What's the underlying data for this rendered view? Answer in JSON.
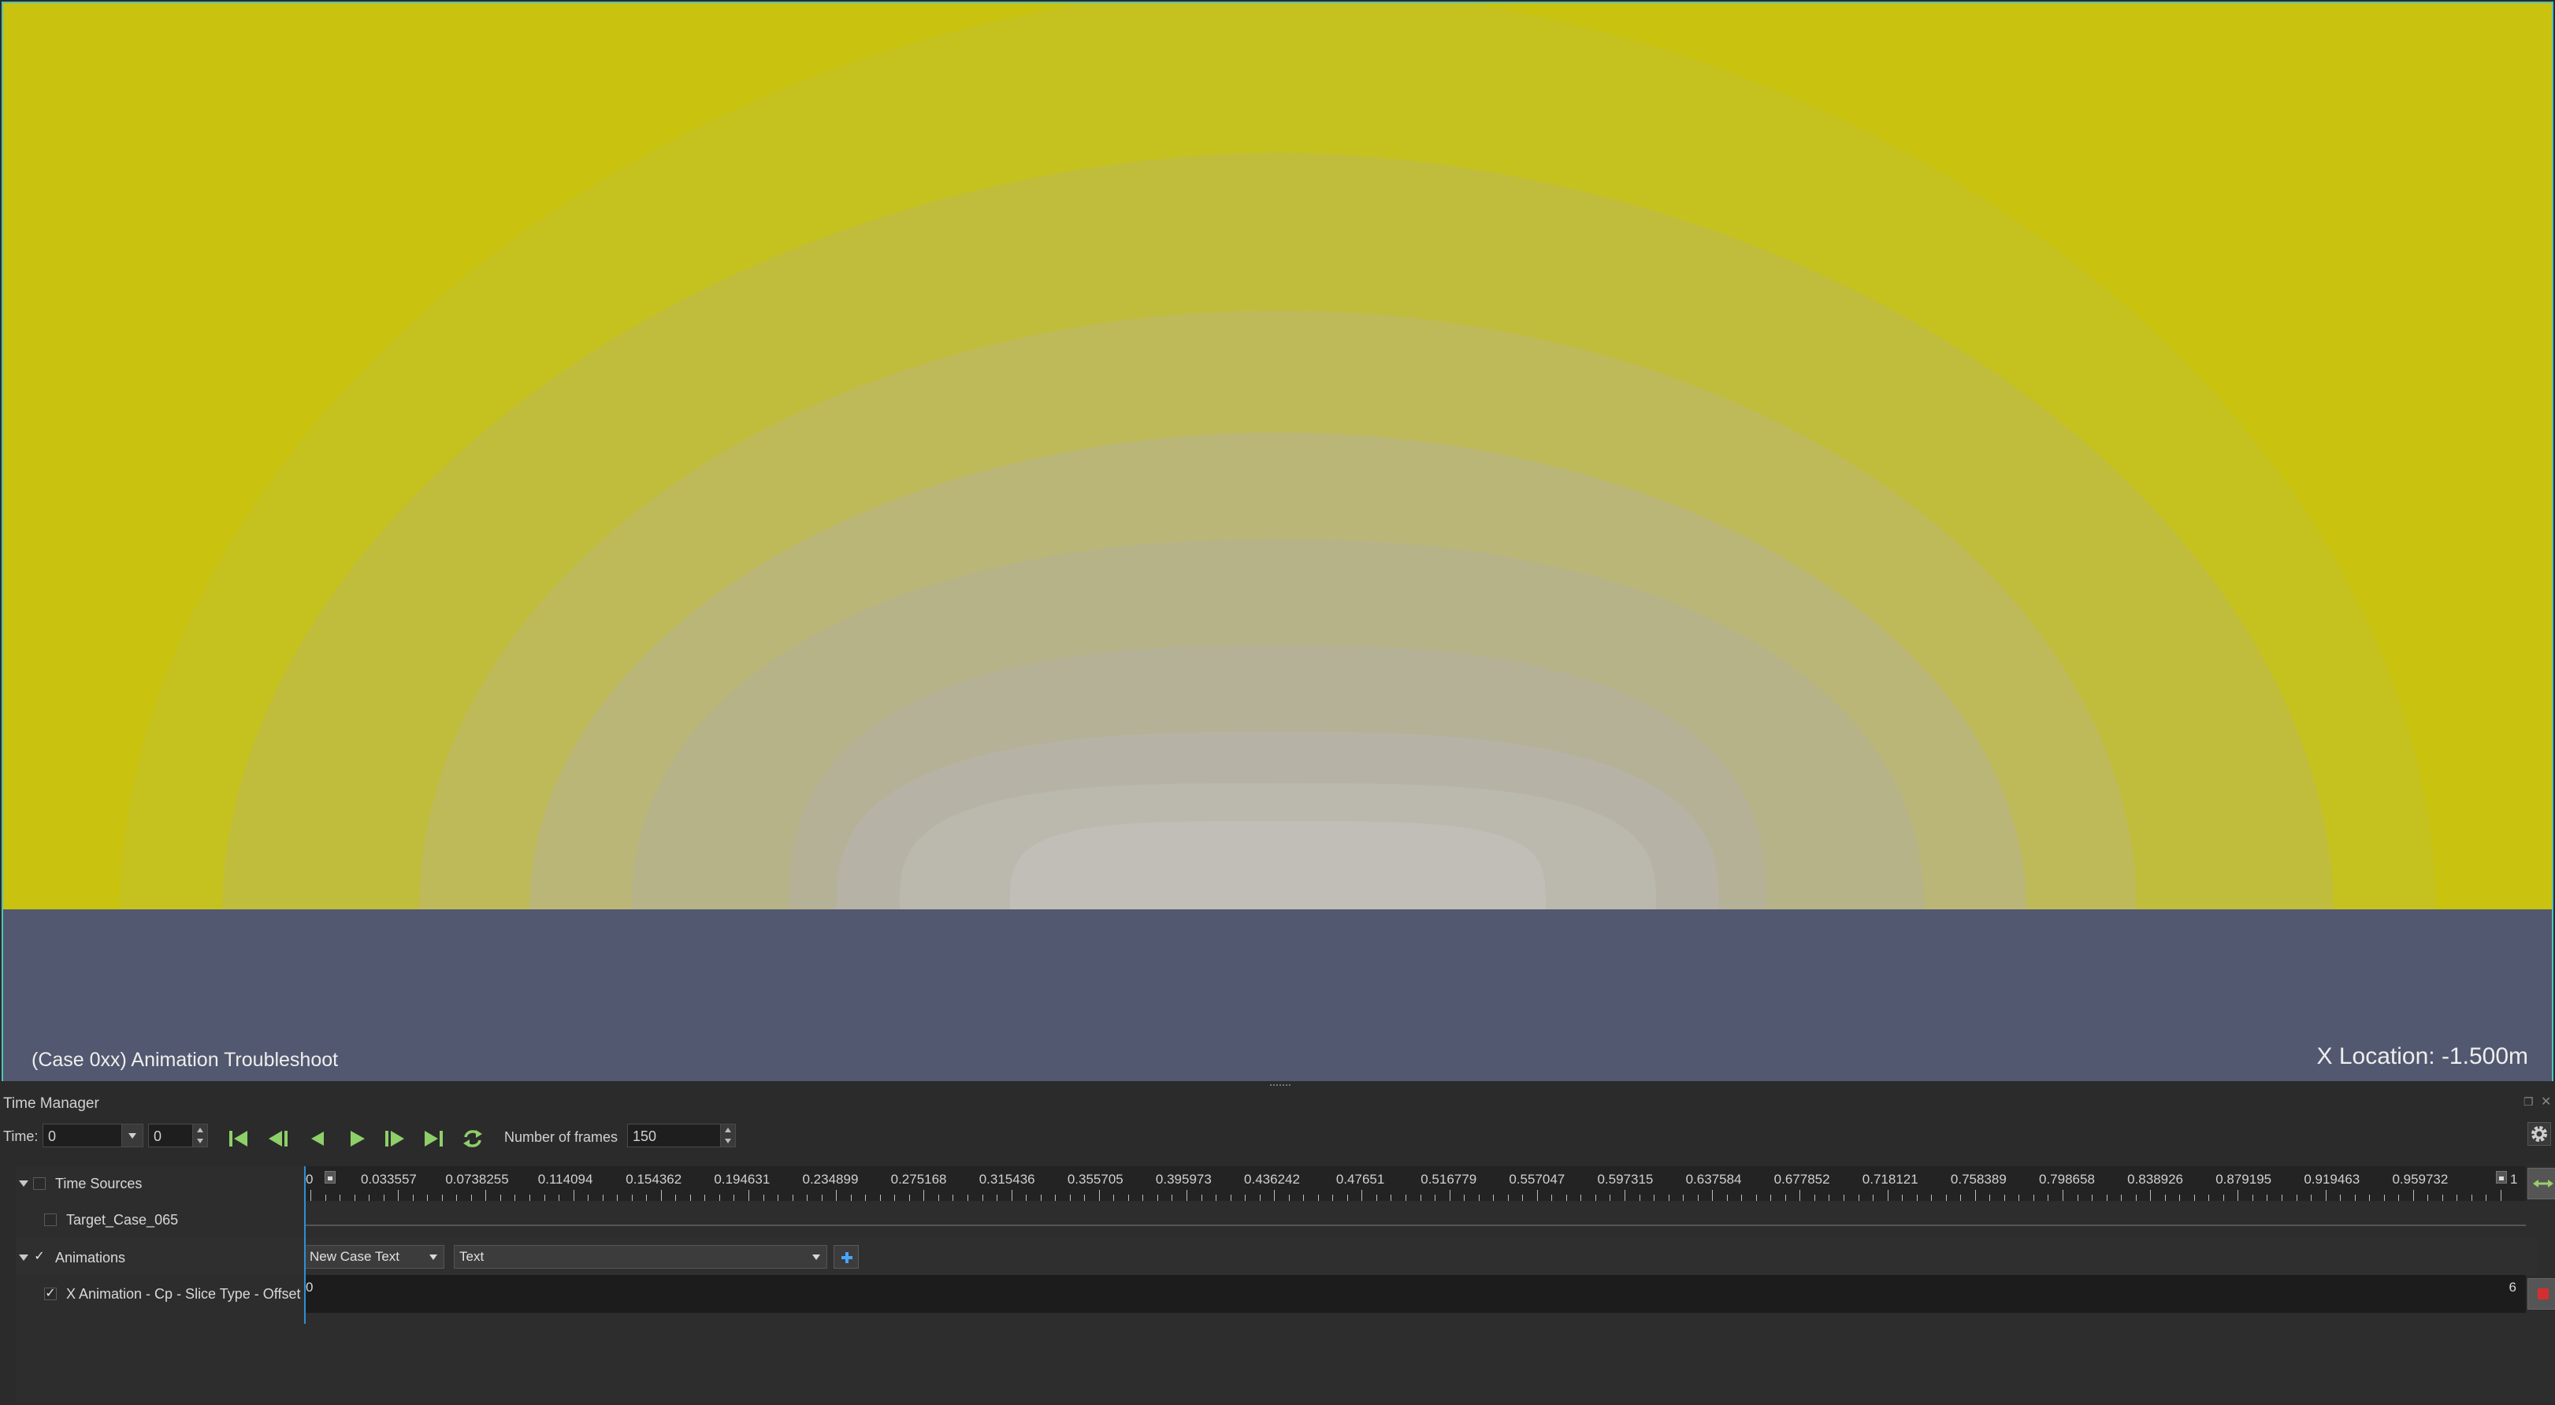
{
  "viewport": {
    "title_text": "(Case 0xx) Animation Troubleshoot",
    "location_text": "X Location: -1.500m",
    "colors": {
      "background": "#c9c20f",
      "band": "#52586f",
      "contour_levels": [
        "#c5c11f",
        "#c1bd3c",
        "#beba5a",
        "#bab678",
        "#b7b389",
        "#b5b196",
        "#b6b3a6",
        "#bbb8ae",
        "#c0beb7"
      ]
    }
  },
  "time_manager": {
    "title": "Time Manager",
    "time_label": "Time:",
    "time_value": "0",
    "time_index": "0",
    "frames_label": "Number of frames",
    "frames_value": "150",
    "playback_icons": [
      "first-frame-icon",
      "previous-frame-icon",
      "reverse-play-icon",
      "play-icon",
      "next-frame-icon",
      "last-frame-icon",
      "loop-icon"
    ],
    "settings_icon": "gear-icon"
  },
  "timeline": {
    "ticks": [
      "0",
      "0.033557",
      "0.0738255",
      "0.114094",
      "0.154362",
      "0.194631",
      "0.234899",
      "0.275168",
      "0.315436",
      "0.355705",
      "0.395973",
      "0.436242",
      "0.47651",
      "0.516779",
      "0.557047",
      "0.597315",
      "0.637584",
      "0.677852",
      "0.718121",
      "0.758389",
      "0.798658",
      "0.838926",
      "0.879195",
      "0.919463",
      "0.959732",
      "1"
    ],
    "range": [
      0,
      1
    ]
  },
  "tree": {
    "time_sources_label": "Time Sources",
    "time_source_item": "Target_Case_065",
    "animations_label": "Animations",
    "animation_item": "X Animation - Cp - Slice Type - Offset",
    "new_case_combo": "New Case Text",
    "text_combo": "Text",
    "track_start": "0",
    "track_end": "6"
  }
}
